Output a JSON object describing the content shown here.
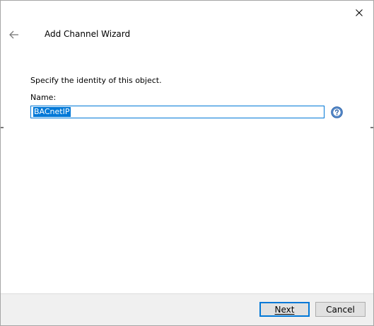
{
  "wizard": {
    "title": "Add Channel Wizard",
    "instruction": "Specify the identity of this object.",
    "name_label": "Name:",
    "name_value": "BACnetIP"
  },
  "buttons": {
    "next_label": "Next",
    "cancel_label": "Cancel"
  },
  "icons": {
    "close": "close-icon",
    "back": "back-arrow-icon",
    "help": "help-icon"
  },
  "colors": {
    "accent": "#0078d7",
    "selection_text": "#ffffff"
  }
}
